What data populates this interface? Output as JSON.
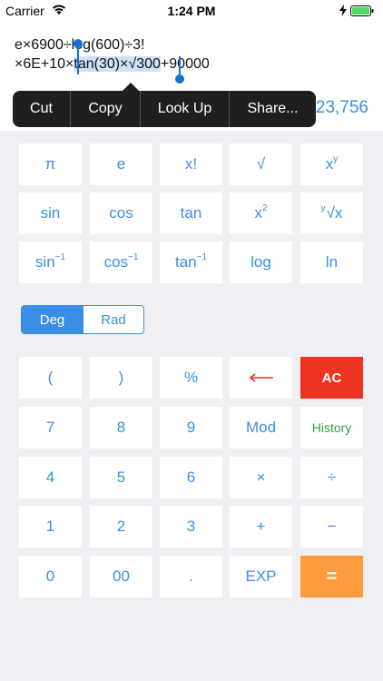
{
  "status_bar": {
    "carrier": "Carrier",
    "time": "1:24 PM"
  },
  "display": {
    "expr_line1": {
      "before": "e×6900÷",
      "selected": "",
      "after": "log(600)÷3!"
    },
    "expr_line2": {
      "before": "×6E+10×",
      "selected": "tan(30)×√300",
      "after": "+90000"
    },
    "result": "23,756"
  },
  "edit_menu": {
    "items": [
      "Cut",
      "Copy",
      "Look Up",
      "Share..."
    ]
  },
  "scientific_keys": {
    "pi": "π",
    "e": "e",
    "factorial": "x!",
    "sqrt": "√",
    "power_base": "x",
    "power_exp": "y",
    "sin": "sin",
    "cos": "cos",
    "tan": "tan",
    "square_base": "x",
    "square_exp": "2",
    "root_index": "y",
    "root_body": "√x",
    "asin_base": "sin",
    "acos_base": "cos",
    "atan_base": "tan",
    "inverse_exp": "−1",
    "log": "log",
    "ln": "ln"
  },
  "mode": {
    "deg": "Deg",
    "rad": "Rad",
    "selected": "Deg"
  },
  "keys": {
    "open_paren": "(",
    "close_paren": ")",
    "percent": "%",
    "clear": "AC",
    "seven": "7",
    "eight": "8",
    "nine": "9",
    "mod": "Mod",
    "history": "History",
    "four": "4",
    "five": "5",
    "six": "6",
    "multiply": "×",
    "divide": "÷",
    "one": "1",
    "two": "2",
    "three": "3",
    "plus": "+",
    "minus": "−",
    "zero": "0",
    "double_zero": "00",
    "decimal": ".",
    "exp": "EXP",
    "equals": "="
  },
  "colors": {
    "accent": "#3a8ee6",
    "clear": "#ee3322",
    "equals": "#fe9b3e",
    "history": "#2ea043",
    "backspace": "#e53326",
    "background": "#efeff4"
  }
}
